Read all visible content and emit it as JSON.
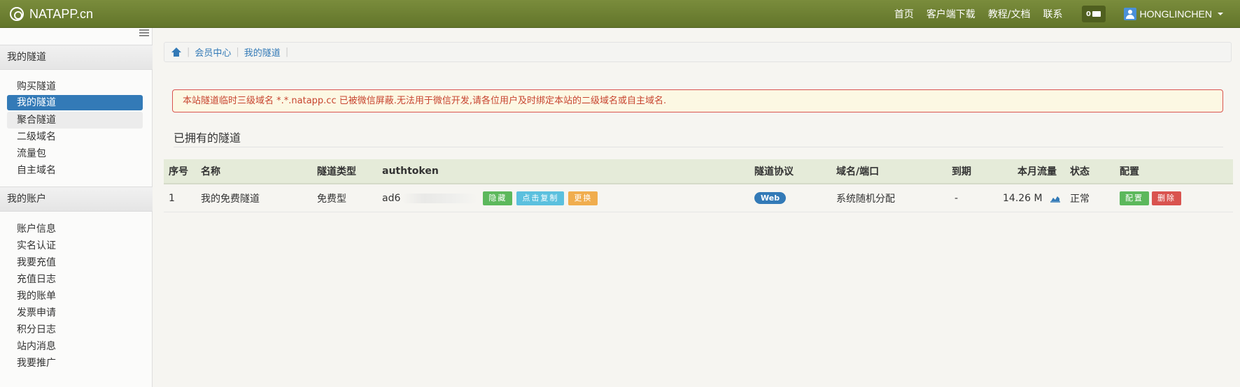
{
  "navbar": {
    "brand": "NATAPP.cn",
    "links": [
      "首页",
      "客户端下载",
      "教程/文档",
      "联系"
    ],
    "message_count": "0",
    "username": "HONGLINCHEN"
  },
  "sidebar": {
    "tunnels_heading": "我的隧道",
    "tunnel_items": [
      "购买隧道",
      "我的隧道",
      "聚合隧道",
      "二级域名",
      "流量包",
      "自主域名"
    ],
    "account_heading": "我的账户",
    "account_items": [
      "账户信息",
      "实名认证",
      "我要充值",
      "充值日志",
      "我的账单",
      "发票申请",
      "积分日志",
      "站内消息",
      "我要推广"
    ]
  },
  "breadcrumb": [
    "会员中心",
    "我的隧道"
  ],
  "alert": "本站隧道临时三级域名 *.*.natapp.cc 已被微信屏蔽.无法用于微信开发,请各位用户及时绑定本站的二级域名或自主域名.",
  "section_title": "已拥有的隧道",
  "table": {
    "headers": {
      "index": "序号",
      "name": "名称",
      "type": "隧道类型",
      "authtoken": "authtoken",
      "protocol": "隧道协议",
      "domain": "域名/端口",
      "expiry": "到期",
      "traffic": "本月流量",
      "status": "状态",
      "config": "配置"
    },
    "rows": [
      {
        "index": "1",
        "name": "我的免费隧道",
        "type": "免费型",
        "authtoken_prefix": "ad6",
        "hide_label": "隐藏",
        "copy_label": "点击复制",
        "change_label": "更换",
        "protocol": "Web",
        "domain": "系统随机分配",
        "expiry": "-",
        "traffic": "14.26 M",
        "status": "正常",
        "config_label": "配置",
        "delete_label": "删除"
      }
    ]
  }
}
